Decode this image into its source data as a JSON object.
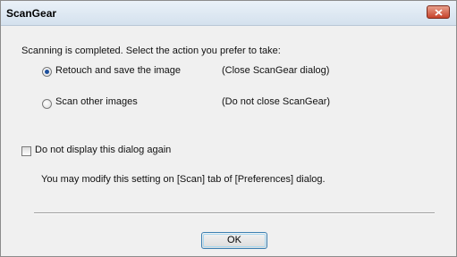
{
  "window": {
    "title": "ScanGear",
    "close_icon": "close-x-icon",
    "accent_color": "#c7432c"
  },
  "dialog": {
    "prompt": "Scanning is completed. Select the action you prefer to take:",
    "options": [
      {
        "label": "Retouch and save the image",
        "note": "(Close ScanGear dialog)",
        "selected": true
      },
      {
        "label": "Scan other images",
        "note": "(Do not close ScanGear)",
        "selected": false
      }
    ],
    "checkbox_label": "Do not display this dialog again",
    "checkbox_checked": false,
    "hint": "You may modify this setting on [Scan] tab of [Preferences] dialog.",
    "ok_label": "OK"
  }
}
